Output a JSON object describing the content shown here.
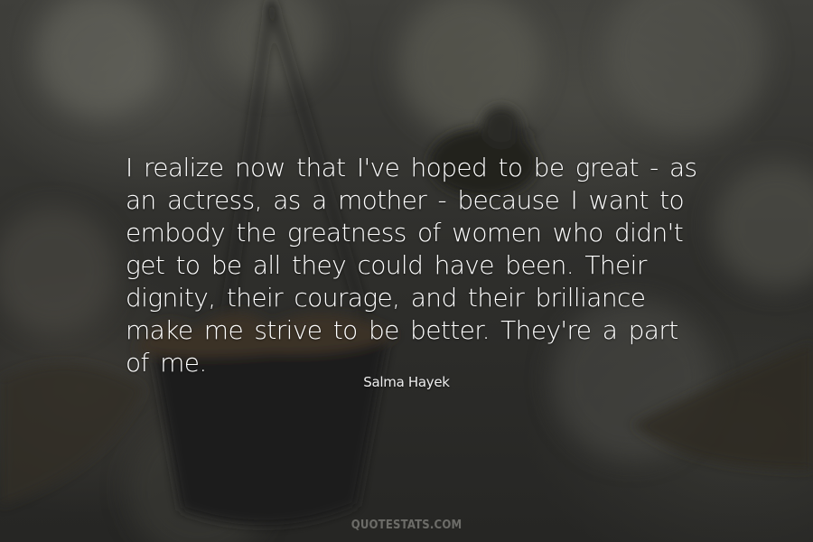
{
  "quote": {
    "text": "I realize now that I've hoped to be great - as an actress, as a mother - because I want to embody the greatness of women who didn't get to be all they could have been. Their dignity, their courage, and their brilliance make me strive to be better. They're a part of me."
  },
  "author": {
    "name": "Salma Hayek"
  },
  "watermark": {
    "text": "QUOTESTATS.COM"
  },
  "colors": {
    "background": "#2d2d2b",
    "text": "#ffffff",
    "watermark": "#6c6c68"
  }
}
